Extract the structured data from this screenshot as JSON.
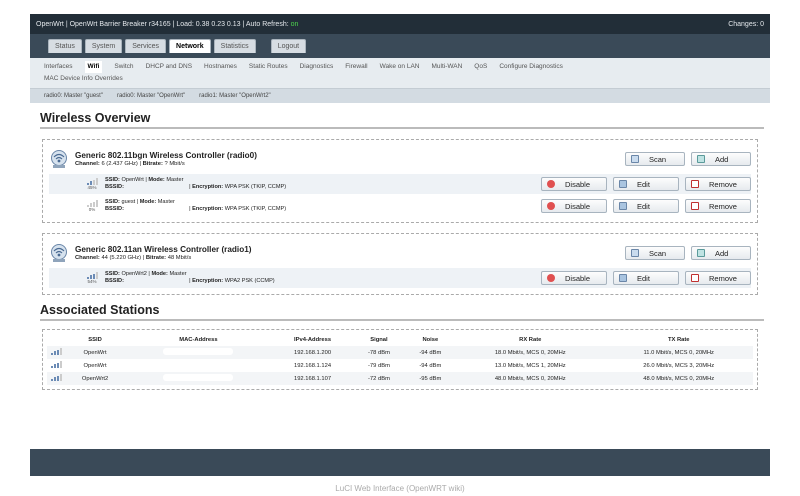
{
  "topbar": {
    "left_text": "OpenWrt | OpenWrt Barrier Breaker r34165 | Load: 0.38 0.23 0.13 | Auto Refresh:",
    "refresh_state": "on",
    "changes": "Changes: 0"
  },
  "main_tabs": [
    "Status",
    "System",
    "Services",
    "Network",
    "Statistics",
    "Logout"
  ],
  "sub_tabs": [
    "Interfaces",
    "Wifi",
    "Switch",
    "DHCP and DNS",
    "Hostnames",
    "Static Routes",
    "Diagnostics",
    "Firewall",
    "Wake on LAN",
    "Multi-WAN",
    "QoS",
    "Configure Diagnostics",
    "MAC Device Info Overrides"
  ],
  "radio_tabs": [
    "radio0: Master \"guest\"",
    "radio0: Master \"OpenWrt\"",
    "radio1: Master \"OpenWrt2\""
  ],
  "wireless_title": "Wireless Overview",
  "buttons": {
    "scan": "Scan",
    "add": "Add",
    "disable": "Disable",
    "edit": "Edit",
    "remove": "Remove"
  },
  "devices": [
    {
      "title": "Generic 802.11bgn Wireless Controller (radio0)",
      "channel_label": "Channel:",
      "channel": "6 (2.437 GHz)",
      "bitrate_label": "Bitrate:",
      "bitrate": "? Mbit/s",
      "networks": [
        {
          "signal": "45%",
          "ssid_line": "OpenWrt",
          "mode": "Master",
          "enc": "WPA PSK (TKIP, CCMP)"
        },
        {
          "signal": "0%",
          "ssid_line": "guest",
          "mode": "Master",
          "enc": "WPA PSK (TKIP, CCMP)"
        }
      ]
    },
    {
      "title": "Generic 802.11an Wireless Controller (radio1)",
      "channel_label": "Channel:",
      "channel": "44 (5.220 GHz)",
      "bitrate_label": "Bitrate:",
      "bitrate": "48 Mbit/s",
      "networks": [
        {
          "signal": "54%",
          "ssid_line": "OpenWrt2",
          "mode": "Master",
          "enc": "WPA2 PSK (CCMP)"
        }
      ]
    }
  ],
  "labels": {
    "ssid": "SSID:",
    "mode": "Mode:",
    "bssid": "BSSID:",
    "encryption": "Encryption:"
  },
  "stations_title": "Associated Stations",
  "stations": {
    "columns": [
      "SSID",
      "MAC-Address",
      "IPv4-Address",
      "Signal",
      "Noise",
      "RX Rate",
      "TX Rate"
    ],
    "rows": [
      {
        "ssid": "OpenWrt",
        "ip": "192.168.1.200",
        "signal": "-78 dBm",
        "noise": "-94 dBm",
        "rx": "18.0 Mbit/s, MCS 0, 20MHz",
        "tx": "11.0 Mbit/s, MCS 0, 20MHz"
      },
      {
        "ssid": "OpenWrt",
        "ip": "192.168.1.124",
        "signal": "-79 dBm",
        "noise": "-94 dBm",
        "rx": "13.0 Mbit/s, MCS 1, 20MHz",
        "tx": "26.0 Mbit/s, MCS 3, 20MHz"
      },
      {
        "ssid": "OpenWrt2",
        "ip": "192.168.1.107",
        "signal": "-72 dBm",
        "noise": "-95 dBm",
        "rx": "48.0 Mbit/s, MCS 0, 20MHz",
        "tx": "48.0 Mbit/s, MCS 0, 20MHz"
      }
    ]
  },
  "caption": "LuCI Web Interface (OpenWRT wiki)"
}
